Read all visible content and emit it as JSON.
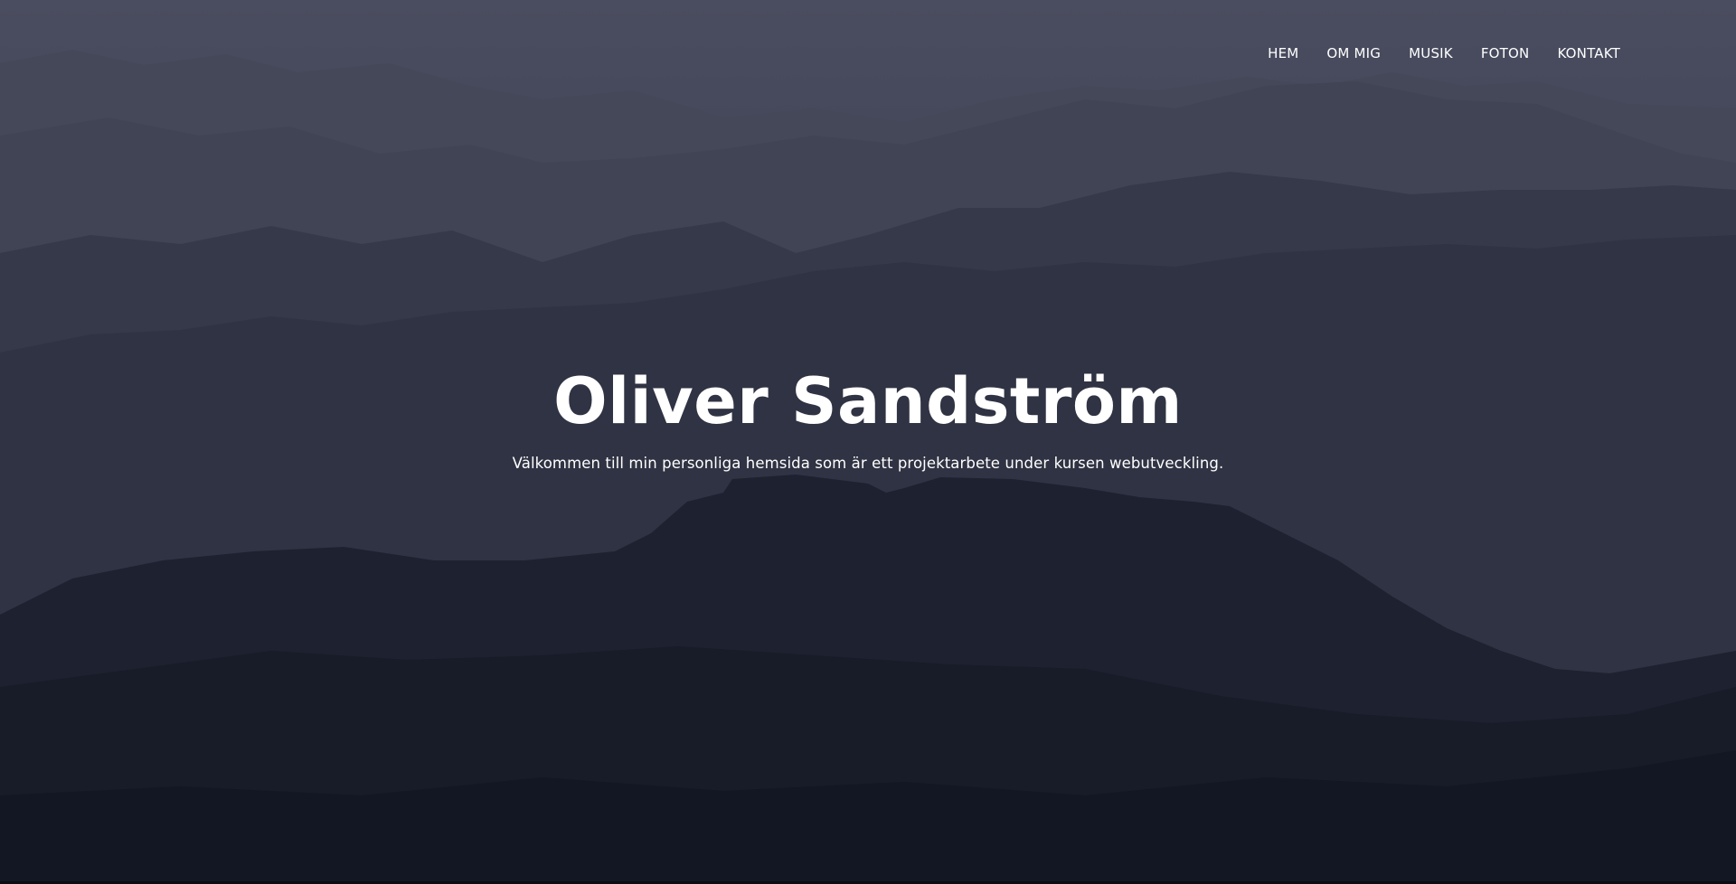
{
  "nav": {
    "items": [
      {
        "label": "HEM"
      },
      {
        "label": "OM MIG"
      },
      {
        "label": "MUSIK"
      },
      {
        "label": "FOTON"
      },
      {
        "label": "KONTAKT"
      }
    ]
  },
  "hero": {
    "title": "Oliver Sandström",
    "subtitle": "Välkommen till min personliga hemsida som är ett projektarbete under kursen webutveckling."
  },
  "colors": {
    "sky_top": "#4a4d5f",
    "ground": "#141725",
    "text": "#ffffff"
  }
}
